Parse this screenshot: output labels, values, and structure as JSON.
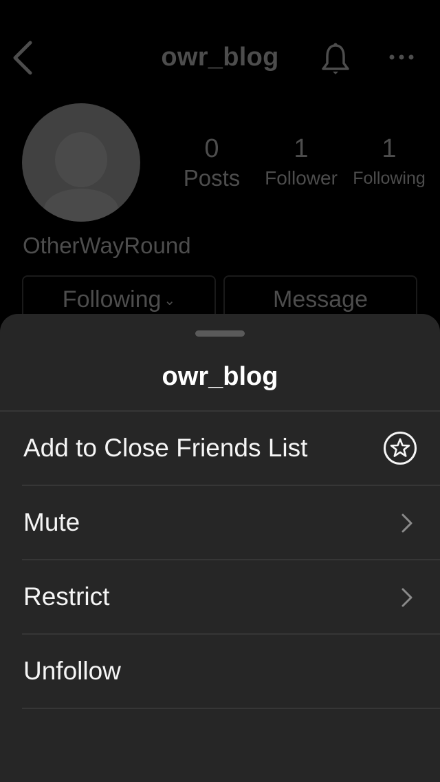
{
  "header": {
    "title": "owr_blog",
    "icons": [
      "back-chevron-icon",
      "bell-icon",
      "more-horizontal-icon"
    ]
  },
  "profile": {
    "avatar": "default-avatar",
    "display_name": "OtherWayRound",
    "stats": [
      {
        "value": "0",
        "label": "Posts"
      },
      {
        "value": "1",
        "label": "Follower"
      },
      {
        "value": "1",
        "label": "Following"
      }
    ],
    "buttons": {
      "following": "Following",
      "message": "Message"
    }
  },
  "sheet": {
    "title": "owr_blog",
    "items": [
      {
        "label": "Add to Close Friends List",
        "icon": "star-circle-icon"
      },
      {
        "label": "Mute",
        "icon": "chevron-right-icon"
      },
      {
        "label": "Restrict",
        "icon": "chevron-right-icon"
      },
      {
        "label": "Unfollow",
        "icon": ""
      }
    ]
  },
  "colors": {
    "sheet_background": "#262626",
    "page_background": "#000000",
    "text_primary": "#ffffff",
    "text_dimmed": "#4d4d4d"
  }
}
